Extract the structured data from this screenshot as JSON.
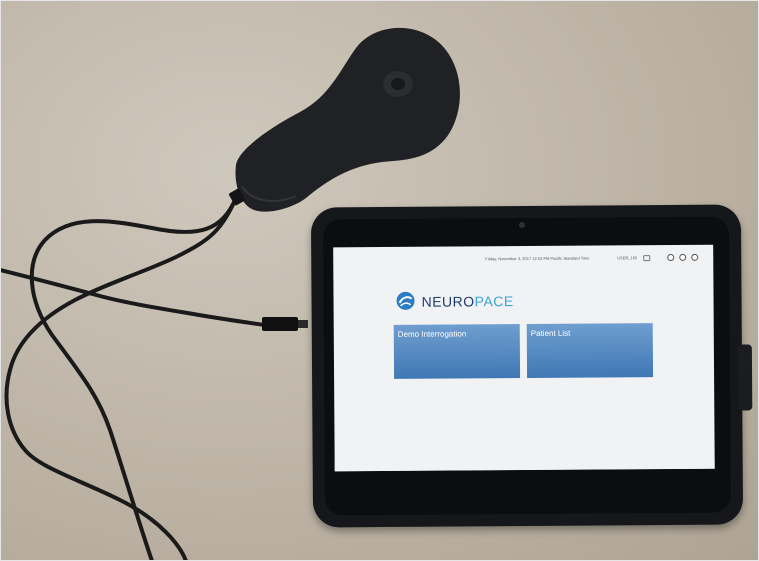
{
  "screen": {
    "status": {
      "datetime_text": "Friday, November 3, 2017 12:53 PM Pacific Standard Time",
      "user_text": "USER_165"
    },
    "brand": {
      "logo_text_a": "NEURO",
      "logo_text_b": "PACE",
      "color_a": "#1d3d70",
      "color_b": "#3aa6d8"
    },
    "tiles": [
      {
        "label": "Demo Interrogation"
      },
      {
        "label": "Patient List"
      }
    ],
    "icons": [
      "lock-icon",
      "home-icon",
      "settings-icon",
      "close-icon"
    ]
  },
  "colors": {
    "tile_top": "#6f9ecf",
    "tile_bottom": "#3f78b5",
    "tablet_body": "#16171a",
    "desk": "#bdb4a6"
  }
}
